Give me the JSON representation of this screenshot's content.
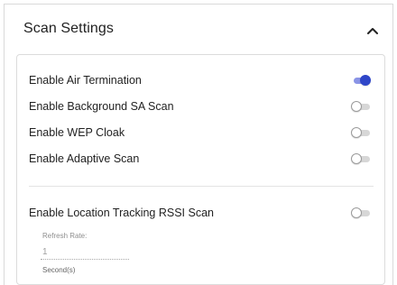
{
  "panel": {
    "title": "Scan Settings",
    "collapse_icon": "chevron-up-icon"
  },
  "toggles": [
    {
      "label": "Enable Air Termination",
      "on": true
    },
    {
      "label": "Enable Background SA Scan",
      "on": false
    },
    {
      "label": "Enable WEP Cloak",
      "on": false
    },
    {
      "label": "Enable Adaptive Scan",
      "on": false
    },
    {
      "label": "Enable Location Tracking RSSI Scan",
      "on": false
    }
  ],
  "refresh_rate": {
    "label": "Refresh Rate:",
    "value": "1",
    "unit": "Second(s)"
  },
  "colors": {
    "toggle_on_thumb": "#2f46c8",
    "toggle_on_track": "#8a94e6",
    "toggle_off_track": "#d7d7d7"
  }
}
